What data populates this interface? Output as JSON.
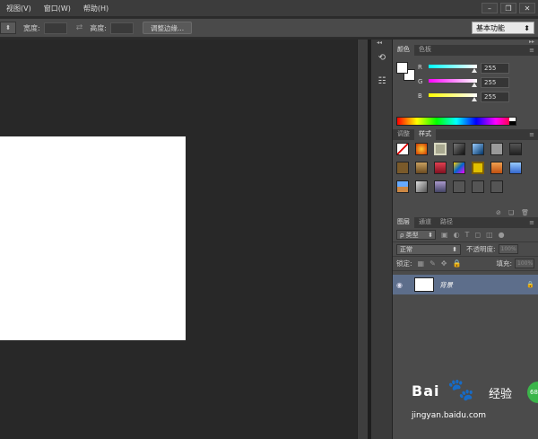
{
  "menu": {
    "items": [
      "视图(V)",
      "窗口(W)",
      "帮助(H)"
    ]
  },
  "options": {
    "width_label": "宽度:",
    "height_label": "高度:",
    "adjust_button": "调整边缘...",
    "workspace": "基本功能"
  },
  "colors": {
    "tabs": [
      "颜色",
      "色板"
    ],
    "r_label": "R",
    "g_label": "G",
    "b_label": "B",
    "r_value": "255",
    "g_value": "255",
    "b_value": "255",
    "fg_color": "#ffffff",
    "bg_color": "#ffffff"
  },
  "styles": {
    "tabs": [
      "调整",
      "样式"
    ]
  },
  "layers": {
    "tabs": [
      "图层",
      "通道",
      "路径"
    ],
    "kind_label": "ρ 类型",
    "blend_mode": "正常",
    "opacity_label": "不透明度:",
    "opacity_value": "100%",
    "lock_label": "锁定:",
    "fill_label": "填充:",
    "fill_value": "100%",
    "layer_name": "背景"
  },
  "watermark": {
    "brand": "Bai",
    "brand2": "经验",
    "url": "jingyan.baidu.com",
    "badge": "68"
  }
}
